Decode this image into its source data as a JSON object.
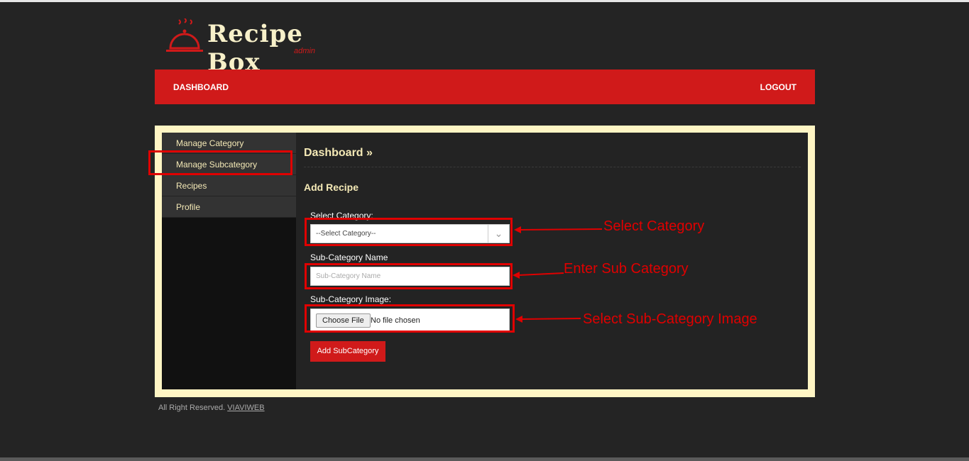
{
  "logo": {
    "title": "Recipe Box",
    "subtitle": "admin"
  },
  "nav": {
    "dashboard": "DASHBOARD",
    "logout": "LOGOUT"
  },
  "sidebar": {
    "items": [
      {
        "label": "Manage Category"
      },
      {
        "label": "Manage Subcategory"
      },
      {
        "label": "Recipes"
      },
      {
        "label": "Profile"
      }
    ]
  },
  "main": {
    "breadcrumb": "Dashboard »",
    "section_title": "Add Recipe",
    "category_label": "Select Category:",
    "category_selected": "--Select Category--",
    "subcat_name_label": "Sub-Category Name",
    "subcat_name_placeholder": "Sub-Category Name",
    "subcat_image_label": "Sub-Category Image:",
    "choose_file_label": "Choose File",
    "file_status": "No file chosen",
    "submit_label": "Add SubCategory"
  },
  "annotations": {
    "select_category": "Select Category",
    "enter_sub_category": "Enter Sub Category",
    "select_image": "Select Sub-Category Image"
  },
  "footer": {
    "text": "All Right Reserved.",
    "link": "VIAVIWEB"
  },
  "colors": {
    "accent": "#d01a1a",
    "frame": "#fff5c4",
    "background": "#242424",
    "annotation": "#e00000"
  }
}
